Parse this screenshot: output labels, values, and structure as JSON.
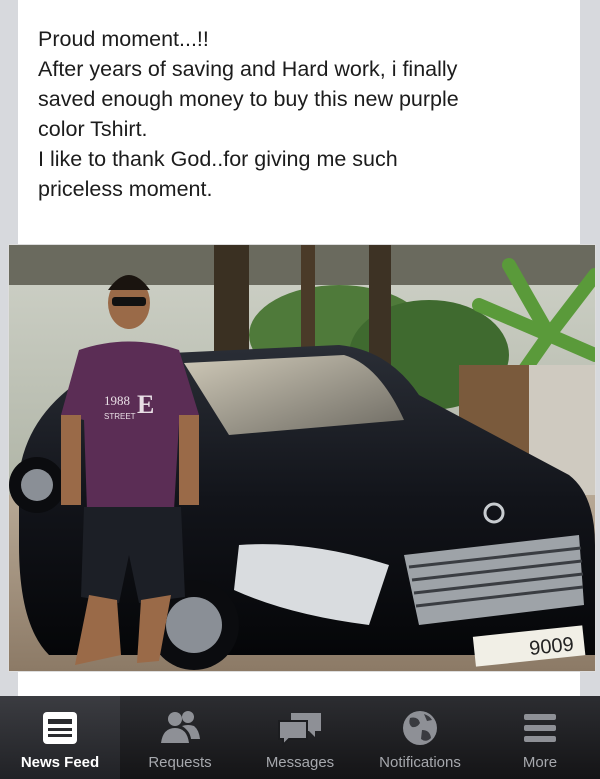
{
  "post": {
    "lines": [
      "Proud moment...!!",
      "After years of saving and Hard work, i finally",
      "saved enough money to buy this new purple",
      "color Tshirt.",
      "I like to thank God..for giving me such",
      "priceless moment."
    ],
    "photo": {
      "shirt_text_1": "1988",
      "shirt_text_2": "E",
      "shirt_text_3": "STREET",
      "plate_text": "9009"
    }
  },
  "tabbar": {
    "tabs": [
      {
        "label": "News Feed",
        "icon": "news-feed-icon",
        "active": true
      },
      {
        "label": "Requests",
        "icon": "requests-icon",
        "active": false
      },
      {
        "label": "Messages",
        "icon": "messages-icon",
        "active": false
      },
      {
        "label": "Notifications",
        "icon": "notifications-icon",
        "active": false
      },
      {
        "label": "More",
        "icon": "more-icon",
        "active": false
      }
    ]
  },
  "colors": {
    "tabbar_bg": "#1e1f22",
    "active_label": "#ffffff",
    "inactive_label": "#a6a8ad"
  }
}
